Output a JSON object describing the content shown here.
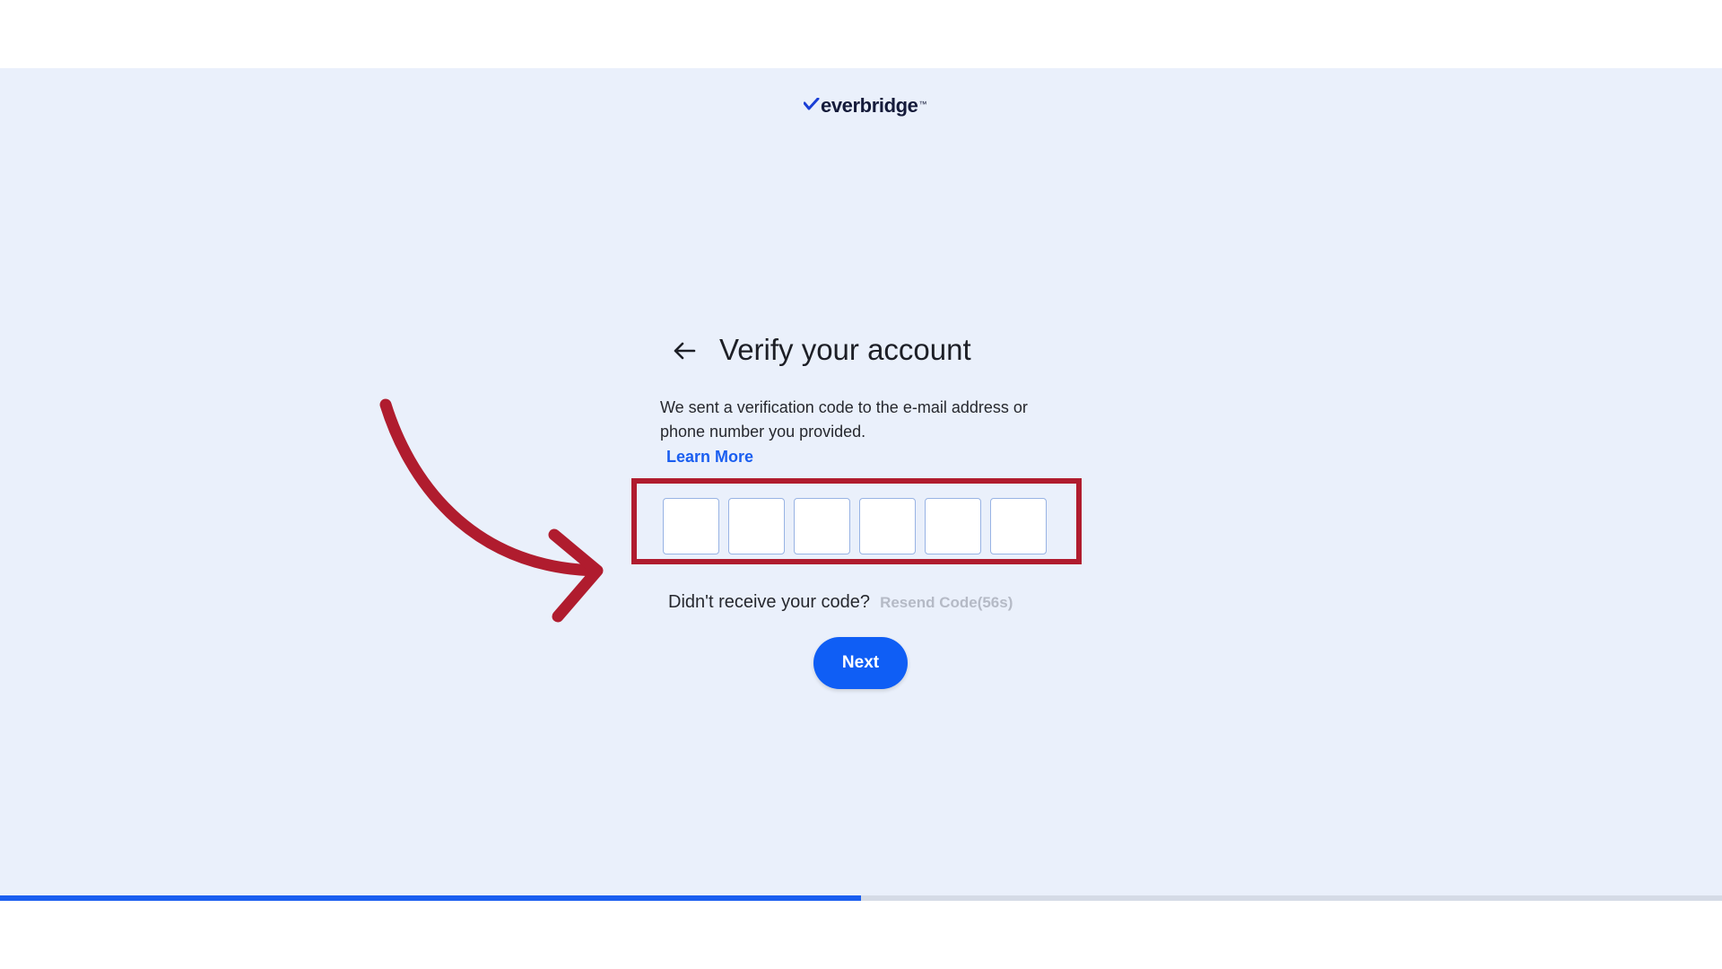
{
  "brand": {
    "logo_text": "everbridge",
    "logo_mark": "™",
    "logo_icon": "checkmark-swoosh-icon",
    "primary_color": "#0f5ef5",
    "text_color": "#151b3a"
  },
  "page": {
    "background": "#eaf0fb"
  },
  "verify": {
    "back_icon": "arrow-left-icon",
    "title": "Verify your account",
    "description": "We sent a verification code to the e-mail address or phone number you provided.",
    "learn_more": "Learn More",
    "code_fields": [
      "",
      "",
      "",
      "",
      "",
      ""
    ],
    "resend_question": "Didn't receive your code?",
    "resend_link": "Resend Code(56s)",
    "next_label": "Next"
  },
  "annotation": {
    "highlight_color": "#b01c2e",
    "arrow_icon": "curved-arrow-icon"
  },
  "progress": {
    "fraction": 0.5,
    "fill_color": "#1a5ef0",
    "track_color": "#d5dbe6"
  }
}
